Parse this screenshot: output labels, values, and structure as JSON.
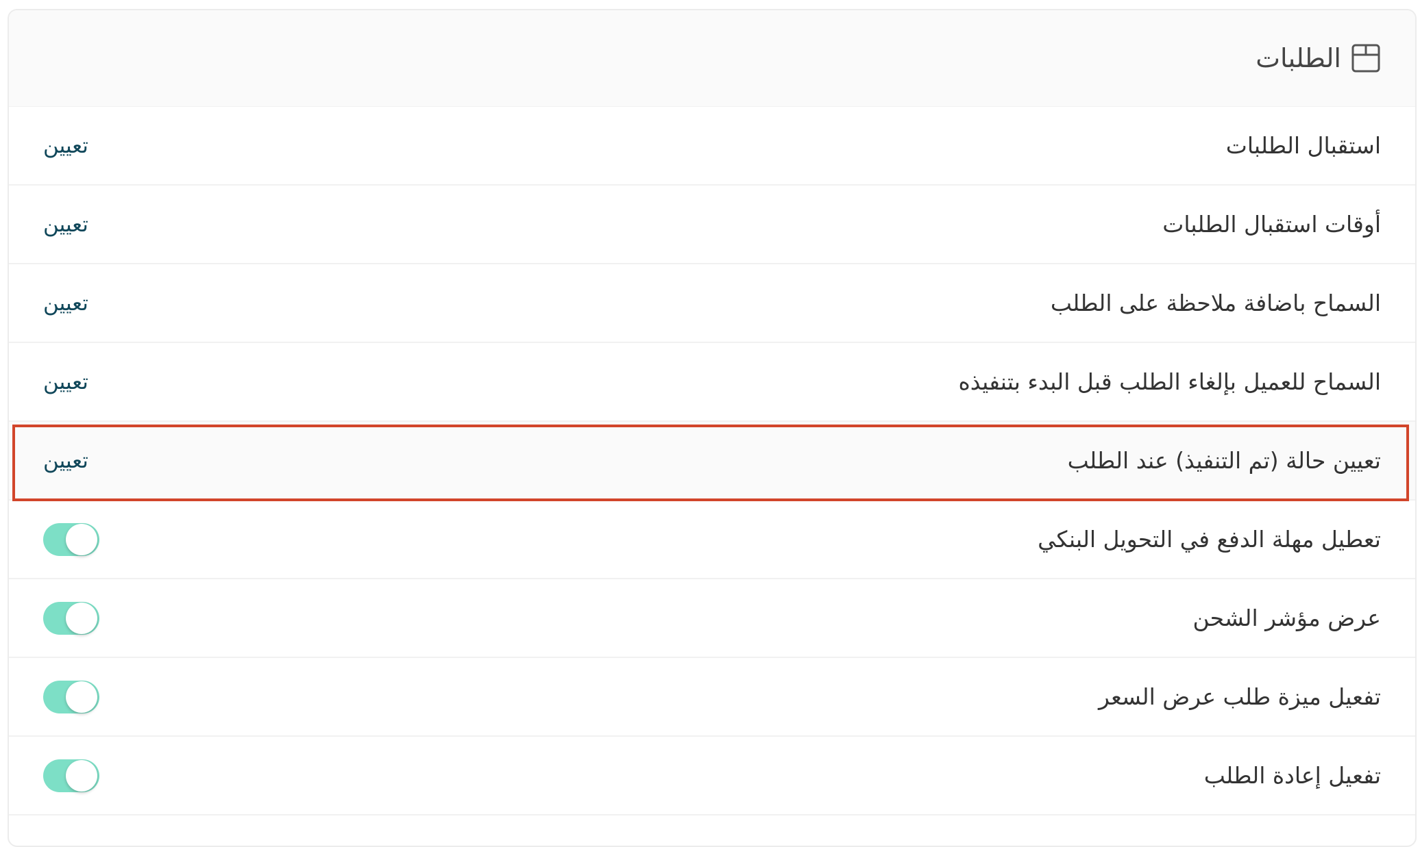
{
  "panel": {
    "title": "الطلبات",
    "icon": "box-icon",
    "accent_color": "#10475a",
    "toggle_on_color": "#7ddfc6",
    "highlight_color": "#d2452a"
  },
  "rows": [
    {
      "label": "استقبال الطلبات",
      "control": "link",
      "action_label": "تعيين"
    },
    {
      "label": "أوقات استقبال الطلبات",
      "control": "link",
      "action_label": "تعيين"
    },
    {
      "label": "السماح باضافة ملاحظة على الطلب",
      "control": "link",
      "action_label": "تعيين"
    },
    {
      "label": "السماح للعميل بإلغاء الطلب قبل البدء بتنفيذه",
      "control": "link",
      "action_label": "تعيين"
    },
    {
      "label": "تعيين حالة (تم التنفيذ) عند الطلب",
      "control": "link",
      "action_label": "تعيين",
      "highlighted": true
    },
    {
      "label": "تعطيل مهلة الدفع في التحويل البنكي",
      "control": "toggle",
      "on": true
    },
    {
      "label": "عرض مؤشر الشحن",
      "control": "toggle",
      "on": true
    },
    {
      "label": "تفعيل ميزة طلب عرض السعر",
      "control": "toggle",
      "on": true
    },
    {
      "label": "تفعيل إعادة الطلب",
      "control": "toggle",
      "on": true
    }
  ]
}
